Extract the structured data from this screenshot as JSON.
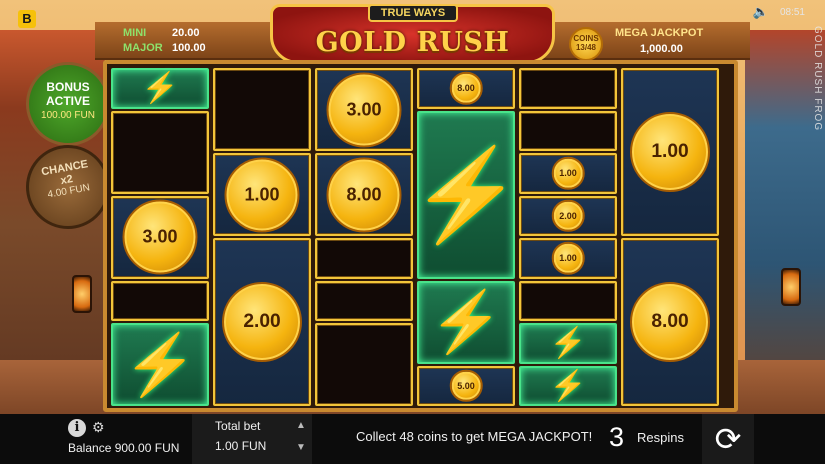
{
  "brand": {
    "logo_letter": "B"
  },
  "header": {
    "game_title": "GOLD RUSH FROG",
    "true_ways": "TRUE WAYS",
    "jackpots": {
      "mini_label": "MINI",
      "mini_value": "20.00",
      "major_label": "MAJOR",
      "major_value": "100.00",
      "mega_label": "MEGA JACKPOT",
      "mega_value": "1,000.00"
    },
    "coins_label": "COINS",
    "coins_value": "13/48"
  },
  "status": {
    "speaker_icon": "speaker-icon",
    "clock": "08:51",
    "side_title": "GOLD RUSH FROG"
  },
  "badges": {
    "bonus_line1": "BONUS",
    "bonus_line2": "ACTIVE",
    "bonus_value": "100.00 FUN",
    "chance_line1": "CHANCE",
    "chance_line2": "x2",
    "chance_value": "4.00 FUN"
  },
  "reels": [
    {
      "cells": [
        {
          "type": "green",
          "symbol": "bolt",
          "h": 1
        },
        {
          "type": "dark",
          "h": 2
        },
        {
          "type": "blue",
          "coin": "3.00",
          "h": 2
        },
        {
          "type": "dark",
          "h": 1
        },
        {
          "type": "green",
          "symbol": "bolt",
          "h": 2
        }
      ]
    },
    {
      "cells": [
        {
          "type": "dark",
          "h": 2
        },
        {
          "type": "blue",
          "coin": "1.00",
          "h": 2
        },
        {
          "type": "blue",
          "coin": "2.00",
          "h": 4
        }
      ]
    },
    {
      "cells": [
        {
          "type": "blue",
          "coin": "3.00",
          "h": 2
        },
        {
          "type": "blue",
          "coin": "8.00",
          "h": 2
        },
        {
          "type": "dark",
          "h": 1
        },
        {
          "type": "dark",
          "h": 1
        },
        {
          "type": "dark",
          "h": 2
        }
      ]
    },
    {
      "cells": [
        {
          "type": "blue",
          "coin": "8.00",
          "h": 1
        },
        {
          "type": "green",
          "symbol": "bolt",
          "h": 4
        },
        {
          "type": "green",
          "symbol": "bolt",
          "h": 2
        },
        {
          "type": "blue",
          "coin": "5.00",
          "h": 1
        }
      ]
    },
    {
      "cells": [
        {
          "type": "dark",
          "h": 1
        },
        {
          "type": "dark",
          "h": 1
        },
        {
          "type": "blue",
          "coin": "1.00",
          "h": 1
        },
        {
          "type": "blue",
          "coin": "2.00",
          "h": 1
        },
        {
          "type": "blue",
          "coin": "1.00",
          "h": 1
        },
        {
          "type": "dark",
          "h": 1
        },
        {
          "type": "green",
          "symbol": "bolt",
          "h": 1
        },
        {
          "type": "green",
          "symbol": "bolt",
          "h": 1
        }
      ]
    },
    {
      "cells": [
        {
          "type": "blue",
          "coin": "1.00",
          "h": 4
        },
        {
          "type": "blue",
          "coin": "8.00",
          "h": 4
        }
      ]
    }
  ],
  "bottom": {
    "info_icon": "i",
    "gear_icon": "⚙",
    "balance": "Balance 900.00 FUN",
    "total_bet_label": "Total bet",
    "total_bet_value": "1.00 FUN",
    "arrow_up": "▲",
    "arrow_down": "▼",
    "message": "Collect 48 coins to get MEGA JACKPOT!",
    "respins_count": "3",
    "respins_label": "Respins",
    "spin_icon": "⟳"
  }
}
